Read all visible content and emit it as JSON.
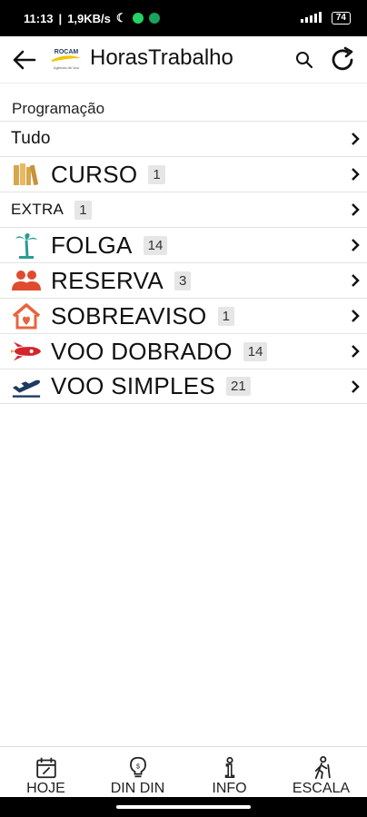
{
  "status_bar": {
    "time": "11:13",
    "speed": "1,9KB/s",
    "battery": "74"
  },
  "header": {
    "title": "HorasTrabalho",
    "logo_text": "ROCAM",
    "logo_tagline": "Agência de Voo"
  },
  "section": {
    "title": "Programação"
  },
  "list": [
    {
      "label": "Tudo",
      "count": null,
      "icon": "none"
    },
    {
      "label": "CURSO",
      "count": "1",
      "icon": "books-icon"
    },
    {
      "label": "EXTRA",
      "count": "1",
      "icon": "none"
    },
    {
      "label": "FOLGA",
      "count": "14",
      "icon": "palm-tree-icon"
    },
    {
      "label": "RESERVA",
      "count": "3",
      "icon": "users-icon"
    },
    {
      "label": "SOBREAVISO",
      "count": "1",
      "icon": "house-icon"
    },
    {
      "label": "VOO DOBRADO",
      "count": "14",
      "icon": "rocket-icon"
    },
    {
      "label": "VOO SIMPLES",
      "count": "21",
      "icon": "plane-departure-icon"
    }
  ],
  "bottom_nav": [
    {
      "label": "HOJE",
      "icon": "calendar-icon"
    },
    {
      "label": "DIN DIN",
      "icon": "lightbulb-icon"
    },
    {
      "label": "INFO",
      "icon": "info-icon"
    },
    {
      "label": "ESCALA",
      "icon": "hiker-icon"
    }
  ],
  "colors": {
    "books": "#d9a54b",
    "palm": "#2a9d8f",
    "users": "#e04a2e",
    "house": "#e8643c",
    "rocket": "#d6242b",
    "plane": "#1d3a5f"
  }
}
